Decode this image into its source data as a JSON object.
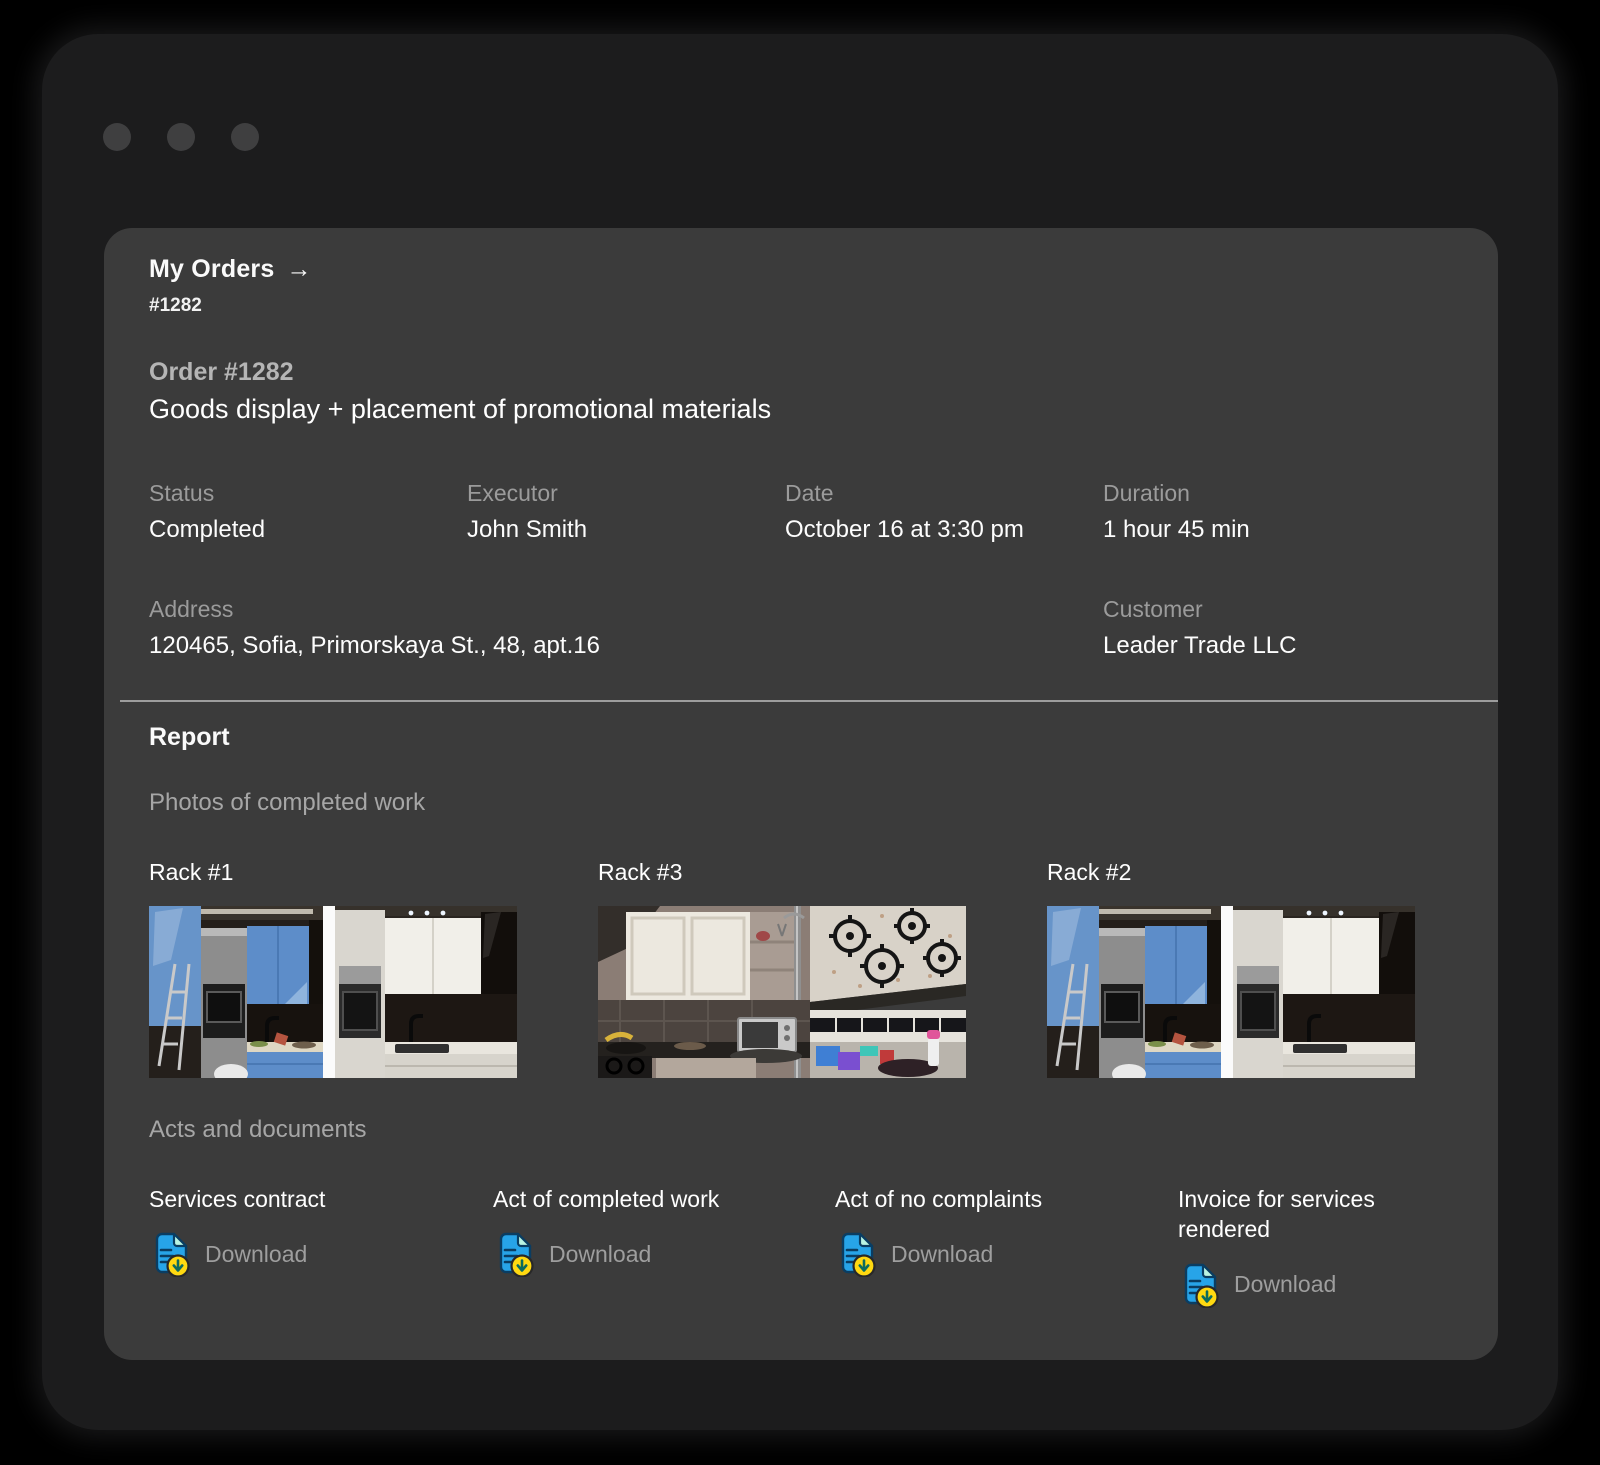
{
  "breadcrumb": {
    "label": "My Orders",
    "arrow": "→",
    "order_ref": "#1282"
  },
  "order": {
    "heading": "Order #1282",
    "title": "Goods display + placement of promotional materials",
    "fields": [
      {
        "label": "Status",
        "value": "Completed"
      },
      {
        "label": "Executor",
        "value": "John Smith"
      },
      {
        "label": "Date",
        "value": "October 16 at 3:30 pm"
      },
      {
        "label": "Duration",
        "value": "1 hour 45 min"
      }
    ],
    "address": {
      "label": "Address",
      "value": "120465, Sofia, Primorskaya St., 48, apt.16"
    },
    "customer": {
      "label": "Customer",
      "value": "Leader Trade LLC"
    }
  },
  "report": {
    "heading": "Report",
    "photos_heading": "Photos of completed work",
    "racks": [
      {
        "label": "Rack #1",
        "photo": "kitchen-comparison-blue-white"
      },
      {
        "label": "Rack #3",
        "photo": "kitchen-old-and-gas-stove"
      },
      {
        "label": "Rack #2",
        "photo": "kitchen-comparison-blue-white"
      }
    ],
    "documents_heading": "Acts and documents",
    "documents": [
      {
        "title": "Services contract",
        "action": "Download"
      },
      {
        "title": "Act of completed work",
        "action": "Download"
      },
      {
        "title": "Act of no complaints",
        "action": "Download"
      },
      {
        "title": "Invoice for services rendered",
        "action": "Download"
      }
    ]
  },
  "colors": {
    "card_bg": "#3b3b3b",
    "window_bg": "#1c1c1d",
    "doc_icon_blue": "#27a4e8",
    "doc_icon_fold": "#b9f4e3",
    "badge_yellow": "#ffd911",
    "label_gray": "#9b9b9b"
  }
}
